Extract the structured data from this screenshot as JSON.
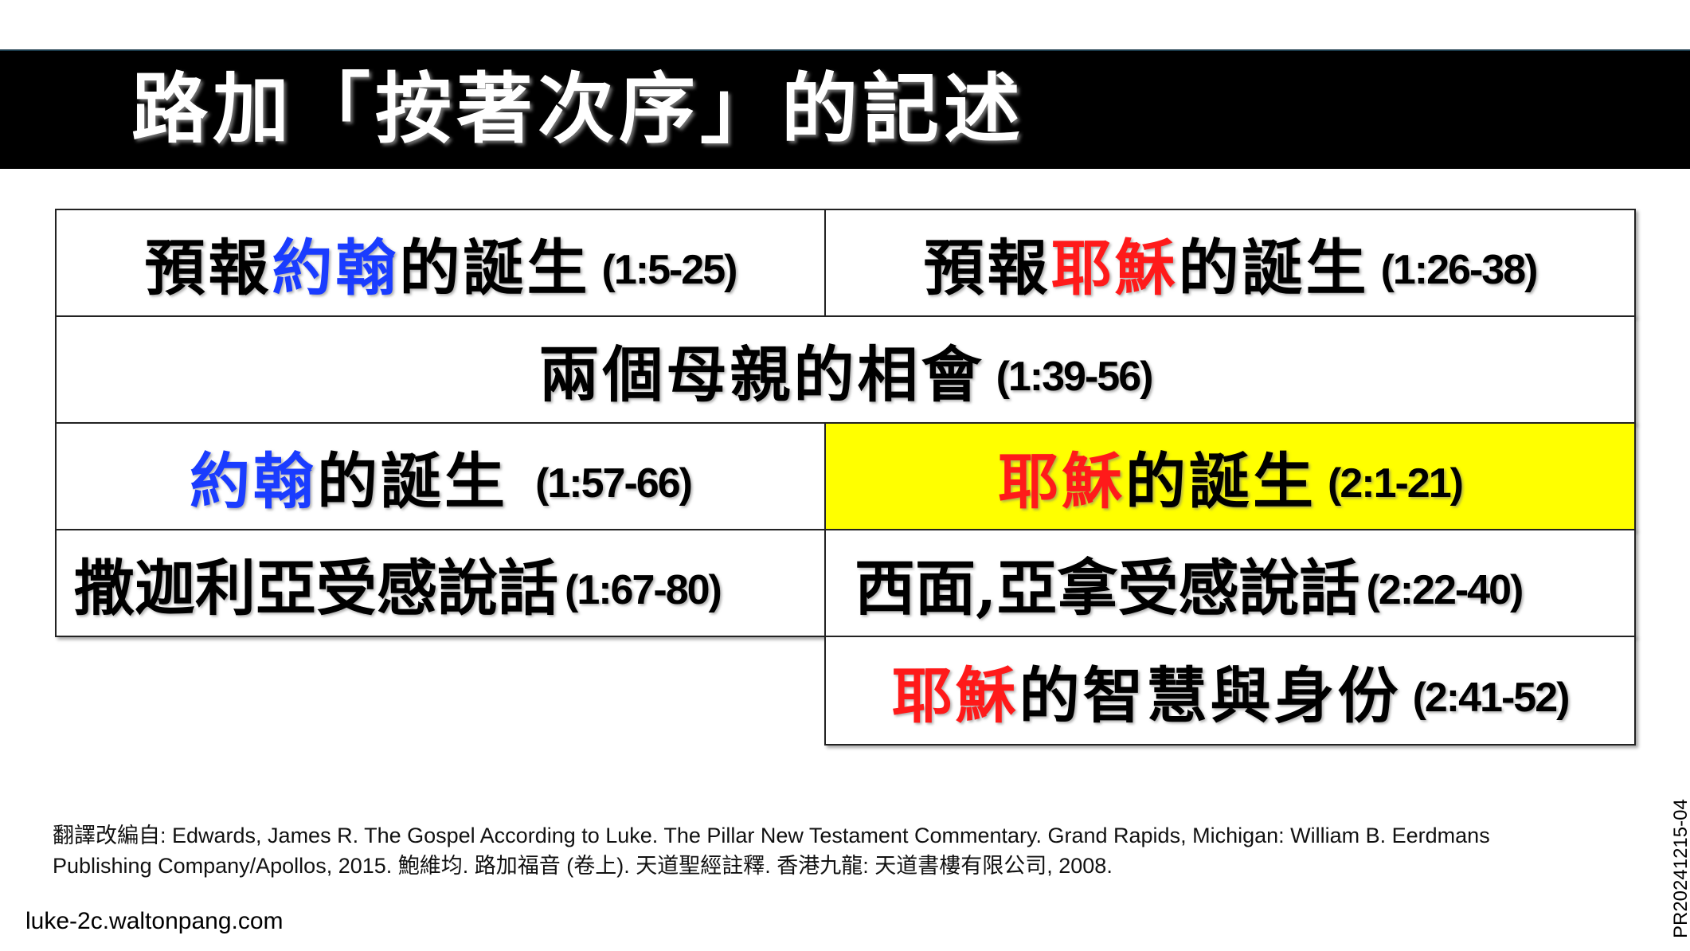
{
  "title": "路加「按著次序」的記述",
  "colors": {
    "blue": "#1a3cff",
    "red": "#ff1a1a",
    "highlight": "#ffff00",
    "title_bg": "#000000"
  },
  "cells": {
    "r1_left": {
      "pre": "預報",
      "name": "約翰",
      "post": "的誕生",
      "ref": "(1:5-25)"
    },
    "r1_right": {
      "pre": "預報",
      "name": "耶穌",
      "post": "的誕生",
      "ref": "(1:26-38)"
    },
    "r2": {
      "text": "兩個母親的相會",
      "ref": "(1:39-56)"
    },
    "r3_left": {
      "name": "約翰",
      "post": "的誕生",
      "ref": "(1:57-66)"
    },
    "r3_right": {
      "name": "耶穌",
      "post": "的誕生",
      "ref": "(2:1-21)"
    },
    "r4_left": {
      "text": "撒迦利亞受感說話",
      "ref": "(1:67-80)"
    },
    "r4_right": {
      "text": "西面,亞拿受感說話",
      "ref": "(2:22-40)"
    },
    "r5_right": {
      "name": "耶穌",
      "post": "的智慧與身份",
      "ref": "(2:41-52)"
    }
  },
  "footnote": {
    "line1": "翻譯改編自: Edwards, James R. The Gospel According to Luke. The Pillar New Testament Commentary. Grand Rapids, Michigan: William B. Eerdmans",
    "line2": "Publishing Company/Apollos, 2015. 鮑維均. 路加福音 (卷上). 天道聖經註釋. 香港九龍: 天道書樓有限公司, 2008."
  },
  "website": "luke-2c.waltonpang.com",
  "slide_code": "PR20241215-04"
}
